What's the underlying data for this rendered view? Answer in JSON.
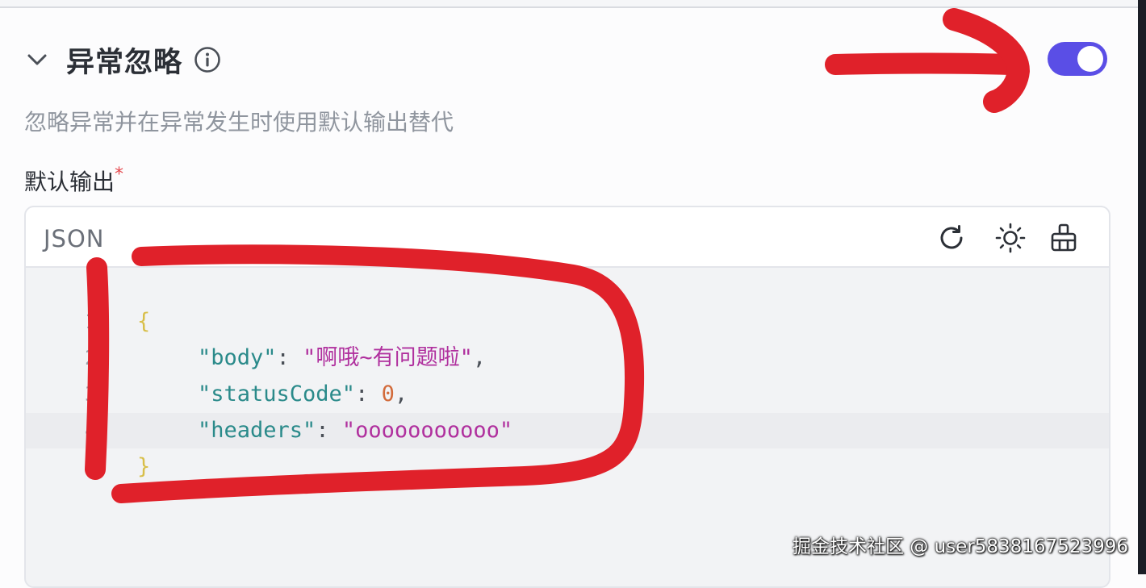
{
  "section": {
    "title": "异常忽略",
    "description": "忽略异常并在异常发生时使用默认输出替代",
    "toggle_on": true
  },
  "field": {
    "label": "默认输出",
    "required_mark": "*"
  },
  "editor": {
    "language": "JSON",
    "tools": [
      "reset-icon",
      "theme-icon",
      "format-icon"
    ],
    "lines": [
      {
        "number": "1",
        "brace": "{"
      },
      {
        "number": "2",
        "key": "\"body\"",
        "sep": ": ",
        "value": "\"啊哦~有问题啦\"",
        "trail": ","
      },
      {
        "number": "3",
        "key": "\"statusCode\"",
        "sep": ": ",
        "value": "0",
        "trail": ","
      },
      {
        "number": "4",
        "key": "\"headers\"",
        "sep": ": ",
        "value": "\"ooooooooooo\"",
        "trail": ""
      },
      {
        "number": "5",
        "brace": "}"
      }
    ]
  },
  "colors": {
    "accent": "#5a4ee6",
    "annotation": "#e0212a",
    "json_key": "#2a8a8a",
    "json_string": "#b0309e",
    "json_number": "#d26a3a"
  },
  "watermark": "掘金技术社区 @ user5838167523996"
}
